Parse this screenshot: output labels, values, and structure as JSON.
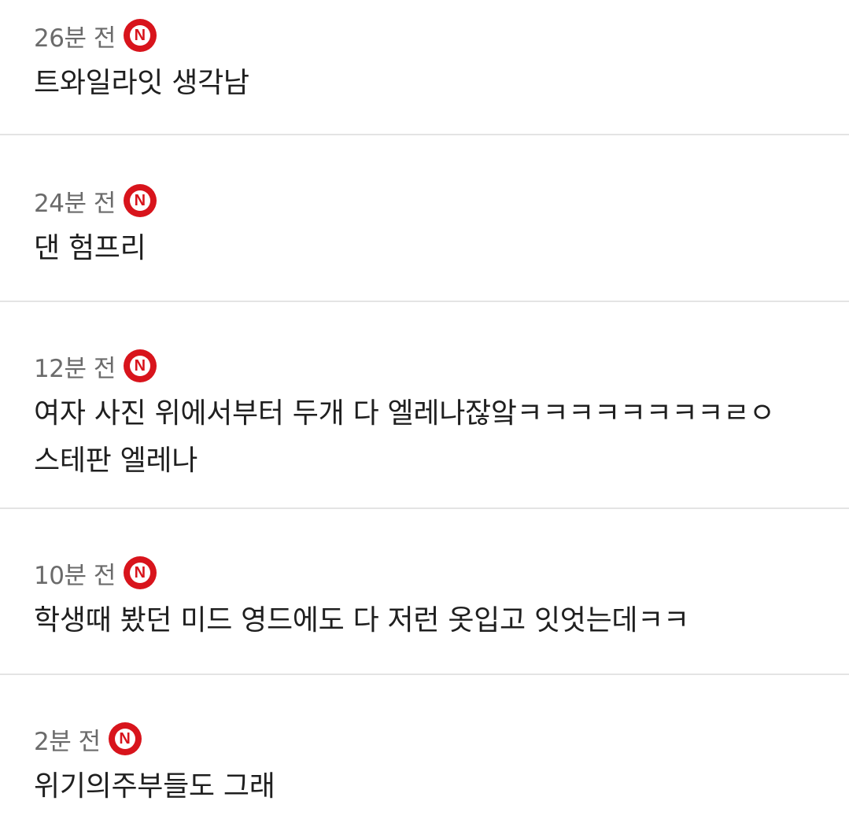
{
  "comments": [
    {
      "time": "26분 전",
      "badge": "N",
      "text": "트와일라잇 생각남"
    },
    {
      "time": "24분 전",
      "badge": "N",
      "text": "댄 험프리"
    },
    {
      "time": "12분 전",
      "badge": "N",
      "text": "여자 사진 위에서부터 두개 다 엘레나잖앜ㅋㅋㅋㅋㅋㅋㅋㅋㄹㅇ\n스테판 엘레나"
    },
    {
      "time": "10분 전",
      "badge": "N",
      "text": "학생때 봤던 미드 영드에도 다 저런 옷입고 잇엇는데ㅋㅋ"
    },
    {
      "time": "2분 전",
      "badge": "N",
      "text": "위기의주부들도 그래"
    }
  ],
  "colors": {
    "badge": "#d8141c",
    "time": "#6b6b6b",
    "text": "#1f1f1f",
    "divider": "#e4e4e4"
  },
  "icons": {
    "new_badge": "new-badge-icon"
  }
}
